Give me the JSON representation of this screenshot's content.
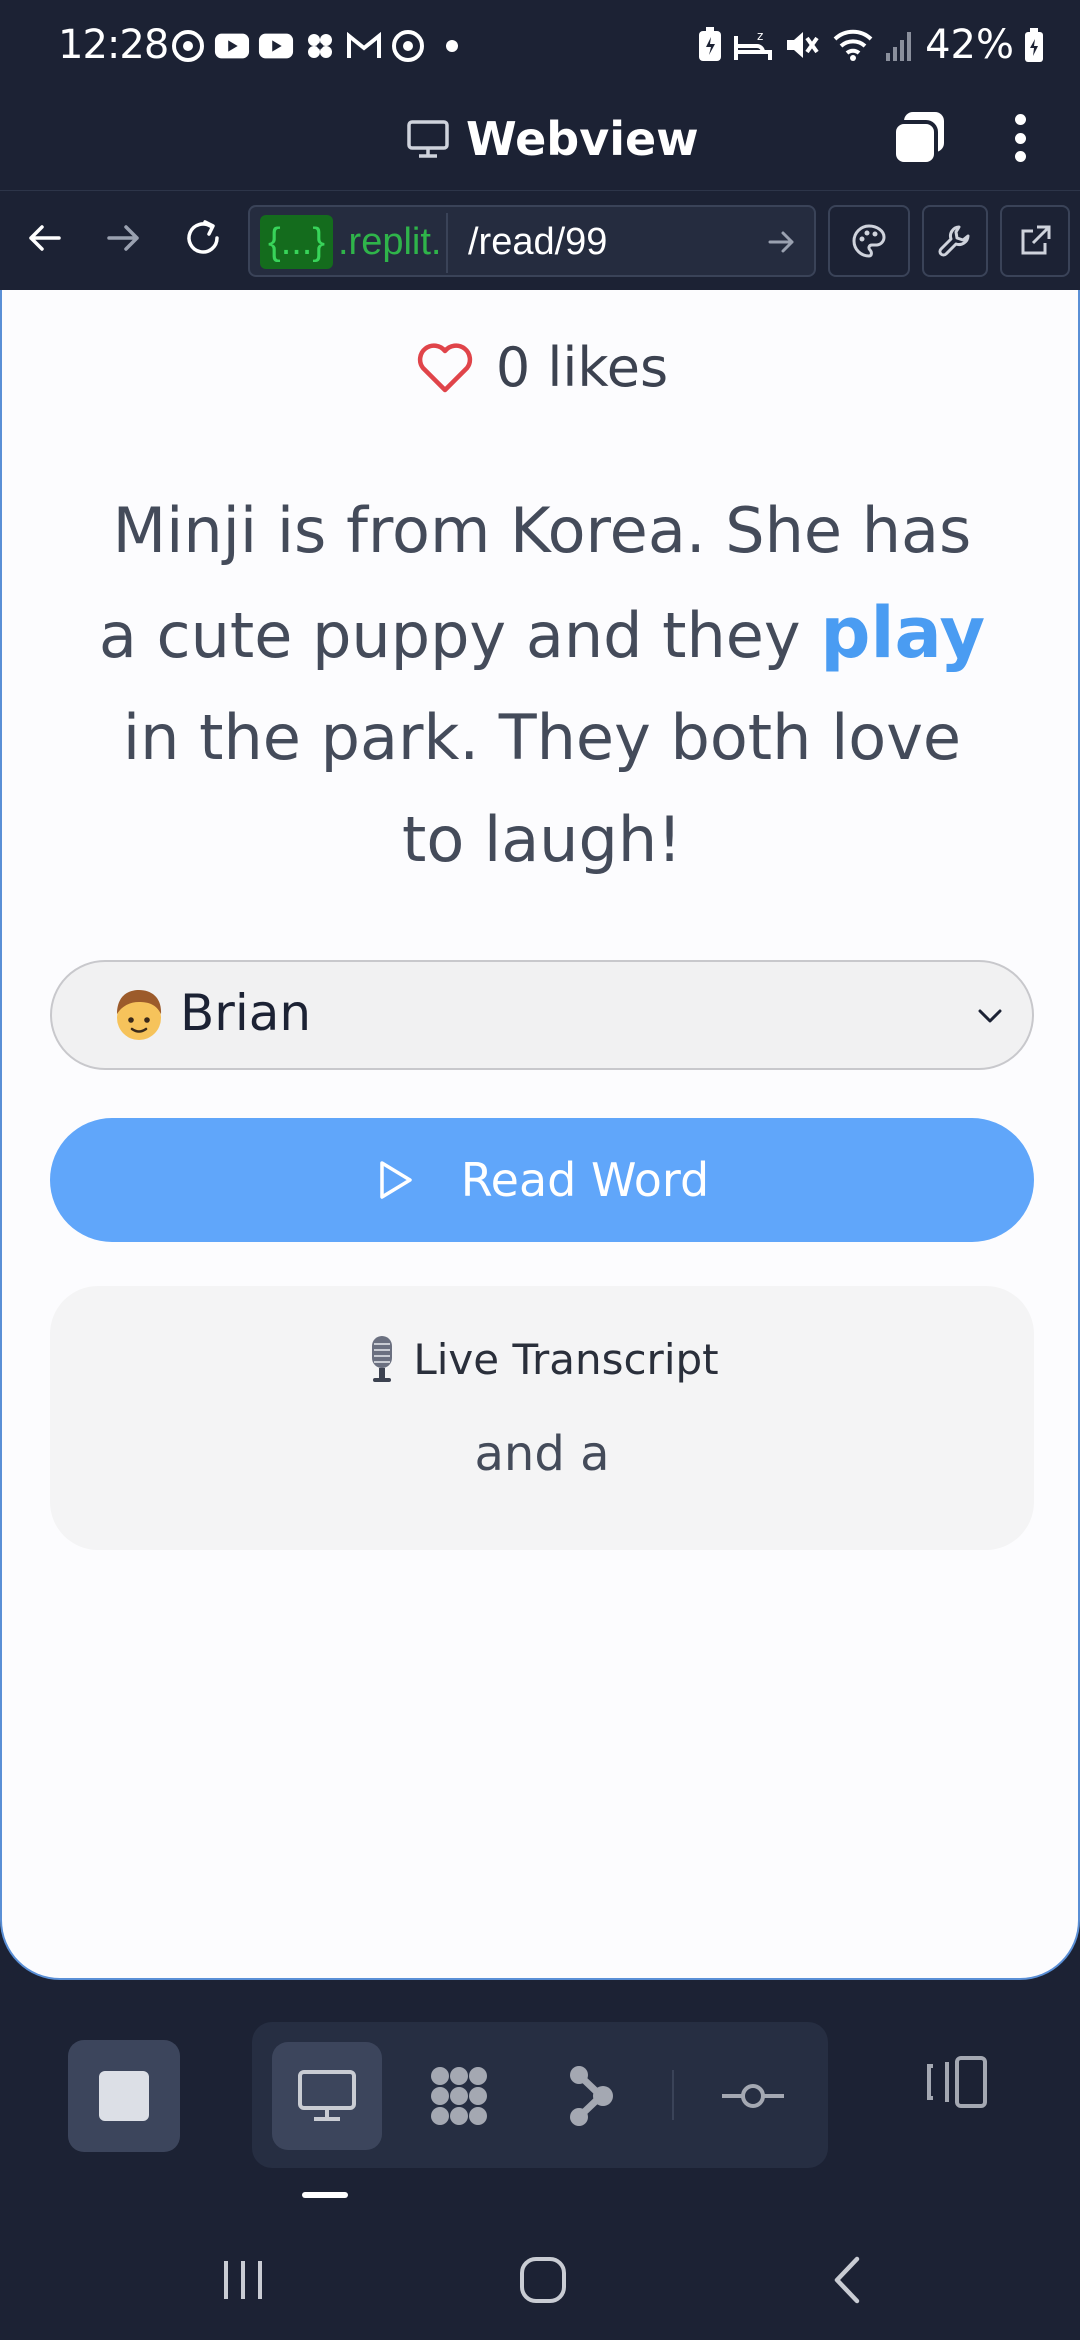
{
  "status_bar": {
    "time": "12:28",
    "battery_percent": "42%"
  },
  "webview": {
    "title": "Webview"
  },
  "browser": {
    "url_badge": "{...}",
    "url_host": ".replit.",
    "url_path": "/read/99"
  },
  "page": {
    "likes": "0 likes",
    "story_before": "Minji is from Korea. She has a cute puppy and they ",
    "story_highlight": "play",
    "story_after": " in the park. They both love to laugh!",
    "voice_selected": "Brian",
    "read_button_label": "Read Word",
    "transcript_title": "Live Transcript",
    "transcript_text": "and a"
  },
  "colors": {
    "accent_blue": "#60a6fa",
    "highlight_word": "#4a9cf2",
    "heart_red": "#e0444a",
    "chrome_dark": "#1c2234"
  }
}
